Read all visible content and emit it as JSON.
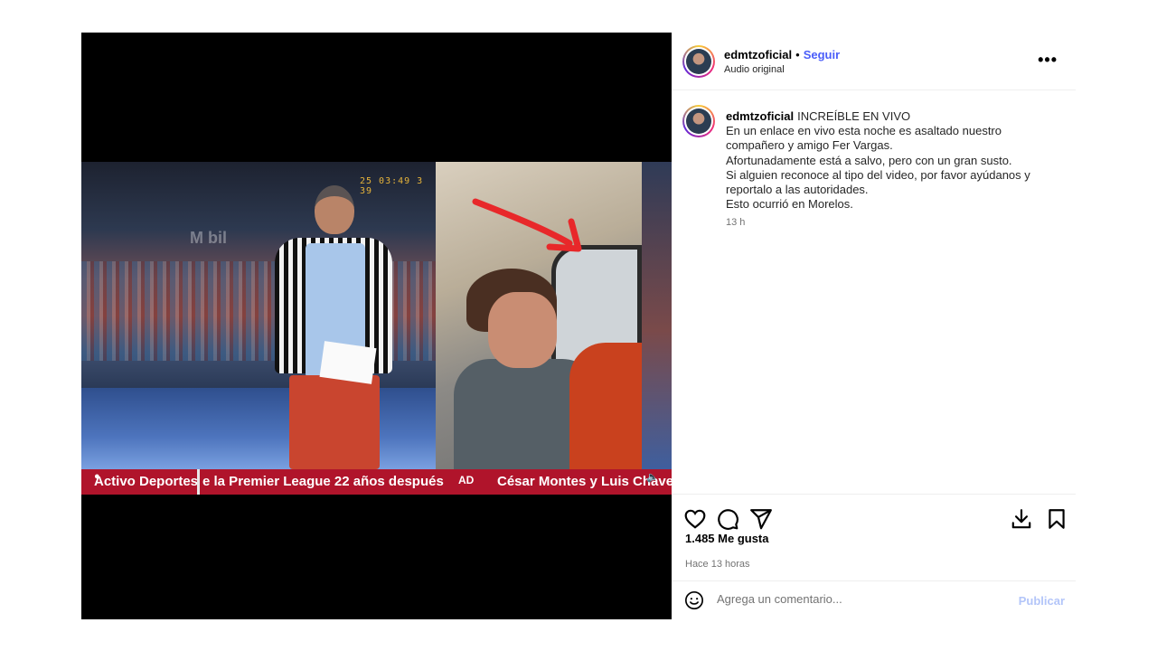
{
  "post": {
    "username": "edmtzoficial",
    "follow_label": "Seguir",
    "audio_label": "Audio original",
    "more_icon": "more-horizontal-icon",
    "caption": {
      "username": "edmtzoficial",
      "lines": [
        "INCREÍBLE EN VIVO",
        "En un enlace en vivo esta noche es asaltado nuestro compañero y amigo Fer Vargas.",
        "Afortunadamente está a salvo, pero con un gran susto.",
        "Si alguien reconoce al tipo del video, por favor ayúdanos y reportalo a las autoridades.",
        "Esto ocurrió en Morelos."
      ],
      "time": "13 h"
    },
    "likes": "1.485 Me gusta",
    "posted_ago": "Hace 13 horas",
    "comment_placeholder": "Agrega un comentario...",
    "publish_label": "Publicar"
  },
  "video": {
    "scoreboard": "25 03:49 3 39",
    "brand_text": "M bil",
    "ticker": {
      "segment_1": "Activo Deportes",
      "segment_2": "e la Premier League 22 años después",
      "logo": "AD",
      "segment_3": "César Montes y Luis Chave"
    },
    "accent_colors": {
      "ticker": "#b0142b",
      "arrow": "#e8282a"
    }
  },
  "colors": {
    "link": "#4a5df9",
    "publish_disabled": "#b3c5f9",
    "muted": "#737373"
  }
}
